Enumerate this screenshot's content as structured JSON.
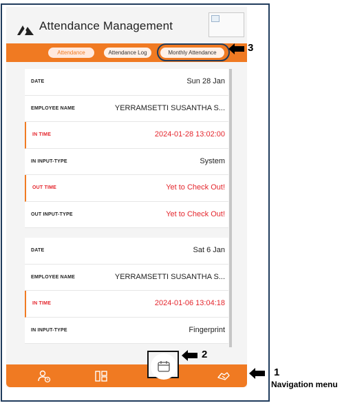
{
  "app": {
    "title": "Attendance Management"
  },
  "tabs": [
    {
      "label": "Attendance",
      "active": true
    },
    {
      "label": "Attendance Log",
      "active": false
    },
    {
      "label": "Monthly Attendance",
      "active": false
    }
  ],
  "records": [
    {
      "date": {
        "label": "DATE",
        "value": "Sun 28 Jan"
      },
      "employee": {
        "label": "EMPLOYEE NAME",
        "value": "YERRAMSETTI SUSANTHA S..."
      },
      "in_time": {
        "label": "IN TIME",
        "value": "2024-01-28 13:02:00"
      },
      "in_input_type": {
        "label": "IN INPUT-TYPE",
        "value": "System"
      },
      "out_time": {
        "label": "OUT TIME",
        "value": "Yet to Check Out!"
      },
      "out_input_type": {
        "label": "OUT INPUT-TYPE",
        "value": "Yet to Check Out!"
      }
    },
    {
      "date": {
        "label": "DATE",
        "value": "Sat 6 Jan"
      },
      "employee": {
        "label": "EMPLOYEE NAME",
        "value": "YERRAMSETTI SUSANTHA S..."
      },
      "in_time": {
        "label": "IN TIME",
        "value": "2024-01-06 13:04:18"
      },
      "in_input_type": {
        "label": "IN INPUT-TYPE",
        "value": "Fingerprint"
      }
    }
  ],
  "nav": {
    "items": [
      {
        "icon": "user-clock-icon"
      },
      {
        "icon": "layout-grid-icon"
      },
      {
        "icon": "calendar-icon"
      },
      {
        "icon": "handshake-icon"
      }
    ]
  },
  "annotations": {
    "marker_1": "1",
    "marker_1_caption": "Navigation menu",
    "marker_2": "2",
    "marker_3": "3"
  },
  "colors": {
    "accent": "#f07a22",
    "alert": "#e4252c",
    "frame": "#1f3b5c"
  }
}
